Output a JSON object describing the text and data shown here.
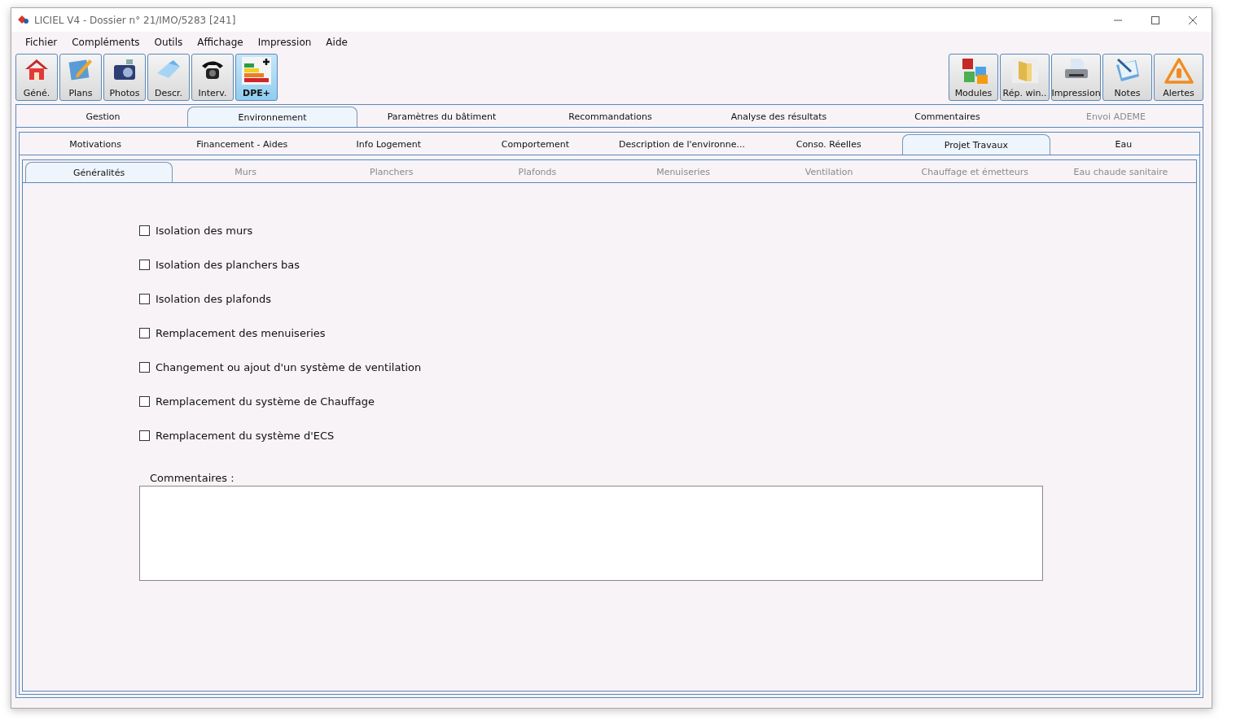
{
  "window": {
    "title": "LICIEL V4 - Dossier n° 21/IMO/5283 [241]"
  },
  "menu": [
    "Fichier",
    "Compléments",
    "Outils",
    "Affichage",
    "Impression",
    "Aide"
  ],
  "toolbar_left": [
    {
      "label": "Géné.",
      "kind": "house",
      "selected": false
    },
    {
      "label": "Plans",
      "kind": "plan",
      "selected": false
    },
    {
      "label": "Photos",
      "kind": "camera",
      "selected": false
    },
    {
      "label": "Descr.",
      "kind": "book",
      "selected": false
    },
    {
      "label": "Interv.",
      "kind": "phone",
      "selected": false
    },
    {
      "label": "DPE+",
      "kind": "energy",
      "selected": true
    }
  ],
  "toolbar_right": [
    {
      "label": "Modules",
      "kind": "puzzle",
      "selected": false
    },
    {
      "label": "Rép. win..",
      "kind": "folder",
      "selected": false
    },
    {
      "label": "Impression",
      "kind": "printer",
      "selected": false
    },
    {
      "label": "Notes",
      "kind": "notes",
      "selected": false
    },
    {
      "label": "Alertes",
      "kind": "warning",
      "selected": false
    }
  ],
  "tabs": [
    {
      "label": "Gestion",
      "selected": false,
      "disabled": false
    },
    {
      "label": "Environnement",
      "selected": true,
      "disabled": false
    },
    {
      "label": "Paramètres du bâtiment",
      "selected": false,
      "disabled": false
    },
    {
      "label": "Recommandations",
      "selected": false,
      "disabled": false
    },
    {
      "label": "Analyse des résultats",
      "selected": false,
      "disabled": false
    },
    {
      "label": "Commentaires",
      "selected": false,
      "disabled": false
    },
    {
      "label": "Envoi ADEME",
      "selected": false,
      "disabled": true
    }
  ],
  "subtabs": [
    {
      "label": "Motivations",
      "selected": false,
      "disabled": false
    },
    {
      "label": "Financement  - Aides",
      "selected": false,
      "disabled": false
    },
    {
      "label": "Info Logement",
      "selected": false,
      "disabled": false
    },
    {
      "label": "Comportement",
      "selected": false,
      "disabled": false
    },
    {
      "label": "Description de l'environne...",
      "selected": false,
      "disabled": false
    },
    {
      "label": "Conso. Réelles",
      "selected": false,
      "disabled": false
    },
    {
      "label": "Projet Travaux",
      "selected": true,
      "disabled": false
    },
    {
      "label": "Eau",
      "selected": false,
      "disabled": false
    }
  ],
  "section_tabs": [
    {
      "label": "Généralités",
      "selected": true,
      "disabled": false
    },
    {
      "label": "Murs",
      "selected": false,
      "disabled": true
    },
    {
      "label": "Planchers",
      "selected": false,
      "disabled": true
    },
    {
      "label": "Plafonds",
      "selected": false,
      "disabled": true
    },
    {
      "label": "Menuiseries",
      "selected": false,
      "disabled": true
    },
    {
      "label": "Ventilation",
      "selected": false,
      "disabled": true
    },
    {
      "label": "Chauffage et émetteurs",
      "selected": false,
      "disabled": true
    },
    {
      "label": "Eau chaude sanitaire",
      "selected": false,
      "disabled": true
    }
  ],
  "checkboxes": [
    {
      "label": "Isolation des murs",
      "checked": false
    },
    {
      "label": "Isolation des planchers bas",
      "checked": false
    },
    {
      "label": "Isolation des plafonds",
      "checked": false
    },
    {
      "label": "Remplacement des menuiseries",
      "checked": false
    },
    {
      "label": "Changement ou ajout d'un système de ventilation",
      "checked": false
    },
    {
      "label": "Remplacement du système de Chauffage",
      "checked": false
    },
    {
      "label": "Remplacement du système d'ECS",
      "checked": false
    }
  ],
  "comments": {
    "label": "Commentaires :"
  }
}
